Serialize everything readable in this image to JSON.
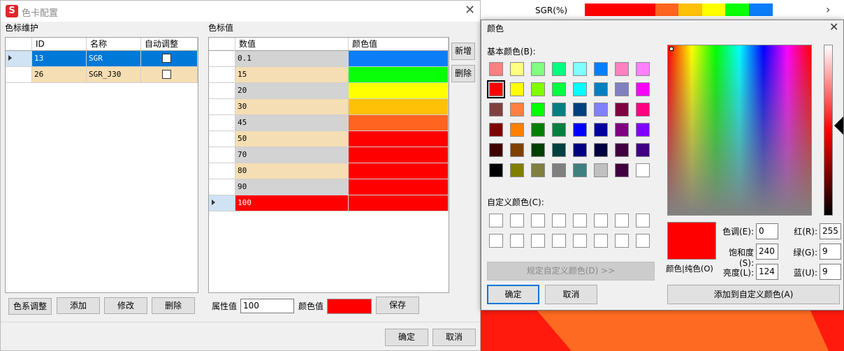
{
  "main": {
    "title": "色卡配置",
    "app_icon_glyph": "S",
    "close_glyph": "✕",
    "left_section": "色标维护",
    "left_headers": [
      "ID",
      "名称",
      "自动调整"
    ],
    "left_rows": [
      {
        "id": "13",
        "name": "SGR",
        "auto": false,
        "selected": true
      },
      {
        "id": "26",
        "name": "SGR_J30",
        "auto": false,
        "selected": false
      }
    ],
    "right_section": "色标值",
    "right_headers": [
      "数值",
      "颜色值"
    ],
    "right_rows": [
      {
        "value": "0.1",
        "color": "#0a7df7"
      },
      {
        "value": "15",
        "color": "#08ff08"
      },
      {
        "value": "20",
        "color": "#ffff00"
      },
      {
        "value": "30",
        "color": "#ffc107"
      },
      {
        "value": "45",
        "color": "#ff6421"
      },
      {
        "value": "50",
        "color": "#ff0000"
      },
      {
        "value": "70",
        "color": "#ff0000"
      },
      {
        "value": "80",
        "color": "#ff0000"
      },
      {
        "value": "90",
        "color": "#ff0000"
      },
      {
        "value": "100",
        "color": "#ff0000"
      }
    ],
    "side_buttons": {
      "add": "新增",
      "delete": "删除"
    },
    "bottom_buttons": {
      "color_adjust": "色系调整",
      "add": "添加",
      "modify": "修改",
      "delete": "删除"
    },
    "attr_label": "属性值",
    "attr_value": "100",
    "color_label": "颜色值",
    "color_value": "#ff0000",
    "save": "保存",
    "ok": "确定",
    "cancel": "取消",
    "colors": {
      "selection": "#0078d7",
      "row_odd": "#d3d3d3",
      "row_even": "#f5deb3"
    }
  },
  "background": {
    "legend_label": "SGR(%)",
    "legend_colors": [
      "#ff0000",
      "#ff0000",
      "#ff0000",
      "#ff6421",
      "#ffc107",
      "#ffff00",
      "#08ff08",
      "#0a7df7"
    ],
    "arrow_glyph": "›"
  },
  "dialog": {
    "title": "颜色",
    "close_glyph": "✕",
    "basic_label": "基本颜色(B):",
    "basic_colors": [
      "#ff8080",
      "#ffff80",
      "#80ff80",
      "#00ff80",
      "#80ffff",
      "#0080ff",
      "#ff80c0",
      "#ff80ff",
      "#ff0000",
      "#ffff00",
      "#80ff00",
      "#00ff40",
      "#00ffff",
      "#0080c0",
      "#8080c0",
      "#ff00ff",
      "#804040",
      "#ff8040",
      "#00ff00",
      "#008080",
      "#004080",
      "#8080ff",
      "#800040",
      "#ff0080",
      "#800000",
      "#ff8000",
      "#008000",
      "#008040",
      "#0000ff",
      "#0000a0",
      "#800080",
      "#8000ff",
      "#400000",
      "#804000",
      "#004000",
      "#004040",
      "#000080",
      "#000040",
      "#400040",
      "#400080",
      "#000000",
      "#808000",
      "#808040",
      "#808080",
      "#408080",
      "#c0c0c0",
      "#400040",
      "#ffffff"
    ],
    "selected_basic_index": 8,
    "custom_label": "自定义颜色(C):",
    "define_custom": "规定自定义颜色(D) >>",
    "ok": "确定",
    "cancel": "取消",
    "add_custom": "添加到自定义颜色(A)",
    "preview_color": "#ff0000",
    "preview_label": "颜色|纯色(O)",
    "hue_label": "色调(E):",
    "hue": "0",
    "sat_label": "饱和度(S):",
    "sat": "240",
    "lum_label": "亮度(L):",
    "lum": "124",
    "red_label": "红(R):",
    "red": "255",
    "green_label": "绿(G):",
    "green": "9",
    "blue_label": "蓝(U):",
    "blue": "9"
  }
}
